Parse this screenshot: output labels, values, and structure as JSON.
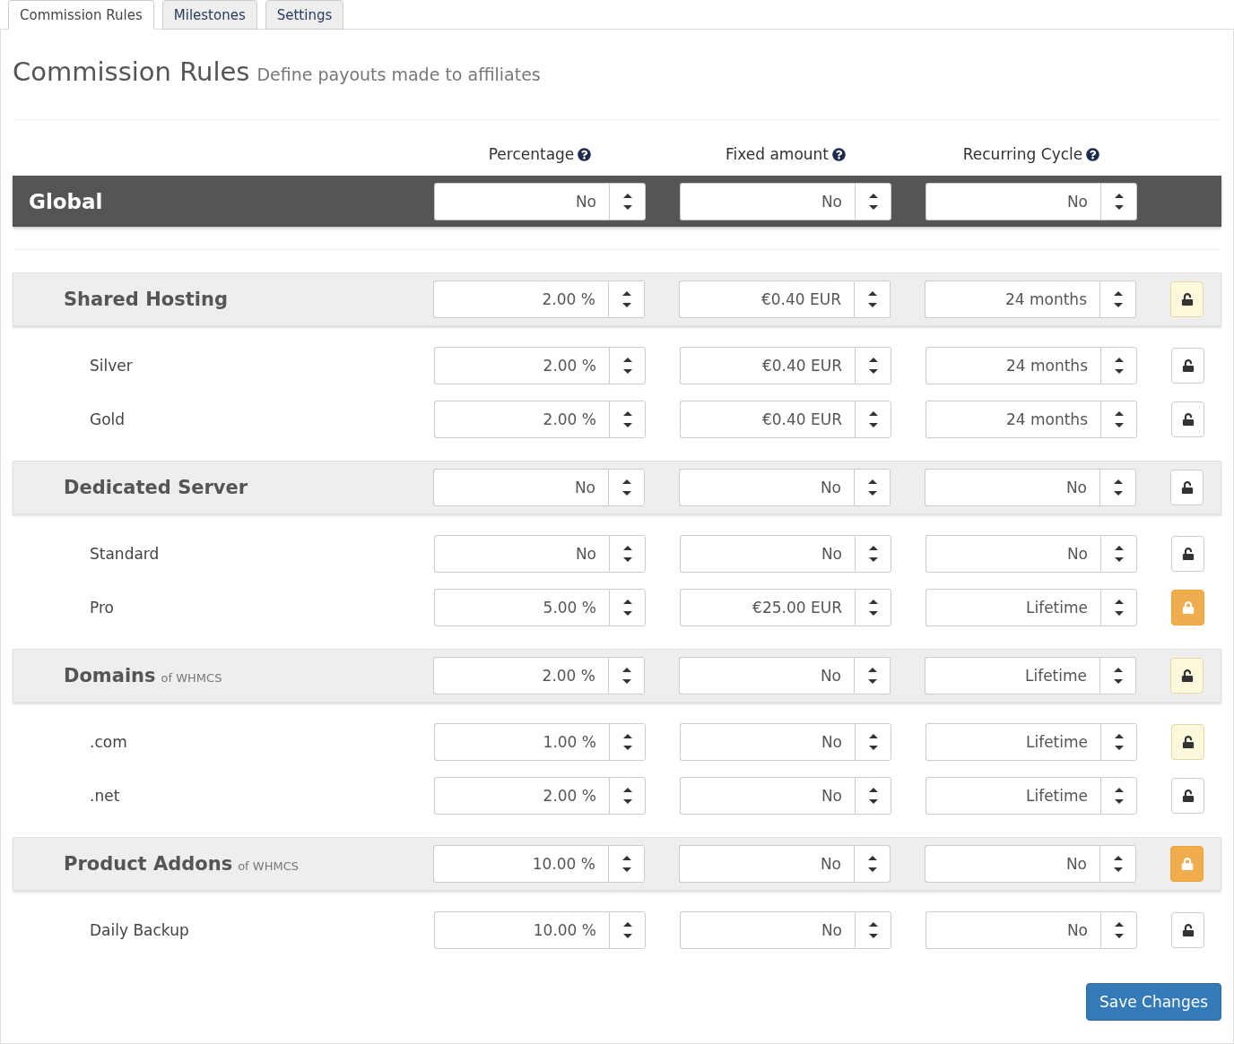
{
  "tabs": [
    {
      "label": "Commission Rules",
      "selected": true
    },
    {
      "label": "Milestones",
      "selected": false
    },
    {
      "label": "Settings",
      "selected": false
    }
  ],
  "heading": {
    "title": "Commission Rules",
    "subtitle": "Define payouts made to affiliates"
  },
  "columns": [
    {
      "label": "Percentage"
    },
    {
      "label": "Fixed amount"
    },
    {
      "label": "Recurring Cycle"
    }
  ],
  "global": {
    "label": "Global",
    "values": [
      "No",
      "No",
      "No"
    ]
  },
  "groups": [
    {
      "name": "Shared Hosting",
      "values": [
        "2.00 %",
        "€0.40 EUR",
        "24 months"
      ],
      "locked": false,
      "modified": true,
      "children": [
        {
          "name": "Silver",
          "values": [
            "2.00 %",
            "€0.40 EUR",
            "24 months"
          ],
          "locked": false,
          "modified": false
        },
        {
          "name": "Gold",
          "values": [
            "2.00 %",
            "€0.40 EUR",
            "24 months"
          ],
          "locked": false,
          "modified": false
        }
      ]
    },
    {
      "name": "Dedicated Server",
      "values": [
        "No",
        "No",
        "No"
      ],
      "locked": false,
      "modified": false,
      "children": [
        {
          "name": "Standard",
          "values": [
            "No",
            "No",
            "No"
          ],
          "locked": false,
          "modified": false
        },
        {
          "name": "Pro",
          "values": [
            "5.00 %",
            "€25.00 EUR",
            "Lifetime"
          ],
          "locked": true,
          "modified": false
        }
      ]
    },
    {
      "name": "Domains",
      "source": "of WHMCS",
      "values": [
        "2.00 %",
        "No",
        "Lifetime"
      ],
      "locked": false,
      "modified": true,
      "children": [
        {
          "name": ".com",
          "values": [
            "1.00 %",
            "No",
            "Lifetime"
          ],
          "locked": false,
          "modified": true
        },
        {
          "name": ".net",
          "values": [
            "2.00 %",
            "No",
            "Lifetime"
          ],
          "locked": false,
          "modified": false
        }
      ]
    },
    {
      "name": "Product Addons",
      "source": "of WHMCS",
      "values": [
        "10.00 %",
        "No",
        "No"
      ],
      "locked": true,
      "modified": false,
      "children": [
        {
          "name": "Daily Backup",
          "values": [
            "10.00 %",
            "No",
            "No"
          ],
          "locked": false,
          "modified": false
        }
      ]
    }
  ],
  "save_button": "Save Changes"
}
